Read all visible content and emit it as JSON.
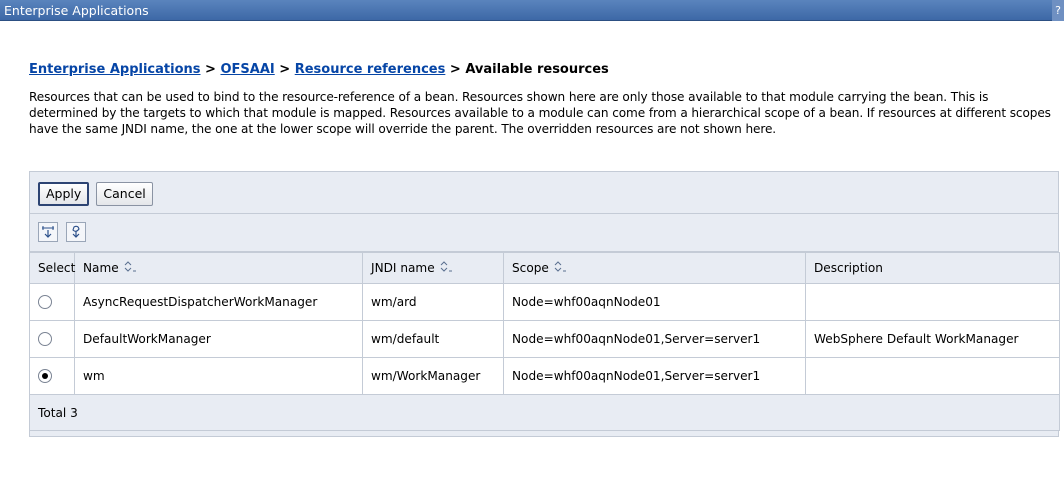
{
  "window": {
    "title": "Enterprise Applications",
    "help_label": "?"
  },
  "breadcrumb": {
    "items": [
      "Enterprise Applications",
      "OFSAAI",
      "Resource references"
    ],
    "separator": ">",
    "current": "Available resources"
  },
  "description": "Resources that can be used to bind to the resource-reference of a bean. Resources shown here are only those available to that module carrying the bean. This is determined by the targets to which that module is mapped. Resources available to a module can come from a hierarchical scope of a bean. If resources at different scopes have the same JNDI name, the one at the lower scope will override the parent. The overridden resources are not shown here.",
  "buttons": {
    "apply": "Apply",
    "cancel": "Cancel"
  },
  "toolbar": [
    "show-filter-icon",
    "clear-filter-icon"
  ],
  "table": {
    "headers": {
      "select": "Select",
      "name": "Name",
      "jndi": "JNDI name",
      "scope": "Scope",
      "description": "Description"
    },
    "rows": [
      {
        "selected": false,
        "name": "AsyncRequestDispatcherWorkManager",
        "jndi": "wm/ard",
        "scope": "Node=whf00aqnNode01",
        "description": ""
      },
      {
        "selected": false,
        "name": "DefaultWorkManager",
        "jndi": "wm/default",
        "scope": "Node=whf00aqnNode01,Server=server1",
        "description": "WebSphere Default WorkManager"
      },
      {
        "selected": true,
        "name": "wm",
        "jndi": "wm/WorkManager",
        "scope": "Node=whf00aqnNode01,Server=server1",
        "description": ""
      }
    ],
    "total": "Total 3"
  },
  "colors": {
    "titlebar": "#4a75b2",
    "link": "#0645a6",
    "panel": "#e8ecf3"
  }
}
